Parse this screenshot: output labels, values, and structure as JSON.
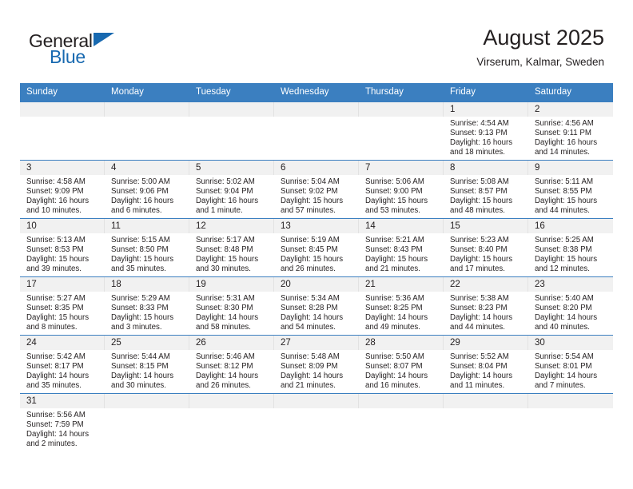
{
  "brand": {
    "name_part1": "General",
    "name_part2": "Blue",
    "accent_color": "#1869b0"
  },
  "header": {
    "title": "August 2025",
    "subtitle": "Virserum, Kalmar, Sweden"
  },
  "theme": {
    "header_blue": "#3b7fc0",
    "day_strip_gray": "#f1f1f1",
    "text": "#231f20"
  },
  "weekdays": [
    "Sunday",
    "Monday",
    "Tuesday",
    "Wednesday",
    "Thursday",
    "Friday",
    "Saturday"
  ],
  "weeks": [
    [
      {
        "day": "",
        "sunrise": "",
        "sunset": "",
        "daylight_line1": "",
        "daylight_line2": ""
      },
      {
        "day": "",
        "sunrise": "",
        "sunset": "",
        "daylight_line1": "",
        "daylight_line2": ""
      },
      {
        "day": "",
        "sunrise": "",
        "sunset": "",
        "daylight_line1": "",
        "daylight_line2": ""
      },
      {
        "day": "",
        "sunrise": "",
        "sunset": "",
        "daylight_line1": "",
        "daylight_line2": ""
      },
      {
        "day": "",
        "sunrise": "",
        "sunset": "",
        "daylight_line1": "",
        "daylight_line2": ""
      },
      {
        "day": "1",
        "sunrise": "Sunrise: 4:54 AM",
        "sunset": "Sunset: 9:13 PM",
        "daylight_line1": "Daylight: 16 hours",
        "daylight_line2": "and 18 minutes."
      },
      {
        "day": "2",
        "sunrise": "Sunrise: 4:56 AM",
        "sunset": "Sunset: 9:11 PM",
        "daylight_line1": "Daylight: 16 hours",
        "daylight_line2": "and 14 minutes."
      }
    ],
    [
      {
        "day": "3",
        "sunrise": "Sunrise: 4:58 AM",
        "sunset": "Sunset: 9:09 PM",
        "daylight_line1": "Daylight: 16 hours",
        "daylight_line2": "and 10 minutes."
      },
      {
        "day": "4",
        "sunrise": "Sunrise: 5:00 AM",
        "sunset": "Sunset: 9:06 PM",
        "daylight_line1": "Daylight: 16 hours",
        "daylight_line2": "and 6 minutes."
      },
      {
        "day": "5",
        "sunrise": "Sunrise: 5:02 AM",
        "sunset": "Sunset: 9:04 PM",
        "daylight_line1": "Daylight: 16 hours",
        "daylight_line2": "and 1 minute."
      },
      {
        "day": "6",
        "sunrise": "Sunrise: 5:04 AM",
        "sunset": "Sunset: 9:02 PM",
        "daylight_line1": "Daylight: 15 hours",
        "daylight_line2": "and 57 minutes."
      },
      {
        "day": "7",
        "sunrise": "Sunrise: 5:06 AM",
        "sunset": "Sunset: 9:00 PM",
        "daylight_line1": "Daylight: 15 hours",
        "daylight_line2": "and 53 minutes."
      },
      {
        "day": "8",
        "sunrise": "Sunrise: 5:08 AM",
        "sunset": "Sunset: 8:57 PM",
        "daylight_line1": "Daylight: 15 hours",
        "daylight_line2": "and 48 minutes."
      },
      {
        "day": "9",
        "sunrise": "Sunrise: 5:11 AM",
        "sunset": "Sunset: 8:55 PM",
        "daylight_line1": "Daylight: 15 hours",
        "daylight_line2": "and 44 minutes."
      }
    ],
    [
      {
        "day": "10",
        "sunrise": "Sunrise: 5:13 AM",
        "sunset": "Sunset: 8:53 PM",
        "daylight_line1": "Daylight: 15 hours",
        "daylight_line2": "and 39 minutes."
      },
      {
        "day": "11",
        "sunrise": "Sunrise: 5:15 AM",
        "sunset": "Sunset: 8:50 PM",
        "daylight_line1": "Daylight: 15 hours",
        "daylight_line2": "and 35 minutes."
      },
      {
        "day": "12",
        "sunrise": "Sunrise: 5:17 AM",
        "sunset": "Sunset: 8:48 PM",
        "daylight_line1": "Daylight: 15 hours",
        "daylight_line2": "and 30 minutes."
      },
      {
        "day": "13",
        "sunrise": "Sunrise: 5:19 AM",
        "sunset": "Sunset: 8:45 PM",
        "daylight_line1": "Daylight: 15 hours",
        "daylight_line2": "and 26 minutes."
      },
      {
        "day": "14",
        "sunrise": "Sunrise: 5:21 AM",
        "sunset": "Sunset: 8:43 PM",
        "daylight_line1": "Daylight: 15 hours",
        "daylight_line2": "and 21 minutes."
      },
      {
        "day": "15",
        "sunrise": "Sunrise: 5:23 AM",
        "sunset": "Sunset: 8:40 PM",
        "daylight_line1": "Daylight: 15 hours",
        "daylight_line2": "and 17 minutes."
      },
      {
        "day": "16",
        "sunrise": "Sunrise: 5:25 AM",
        "sunset": "Sunset: 8:38 PM",
        "daylight_line1": "Daylight: 15 hours",
        "daylight_line2": "and 12 minutes."
      }
    ],
    [
      {
        "day": "17",
        "sunrise": "Sunrise: 5:27 AM",
        "sunset": "Sunset: 8:35 PM",
        "daylight_line1": "Daylight: 15 hours",
        "daylight_line2": "and 8 minutes."
      },
      {
        "day": "18",
        "sunrise": "Sunrise: 5:29 AM",
        "sunset": "Sunset: 8:33 PM",
        "daylight_line1": "Daylight: 15 hours",
        "daylight_line2": "and 3 minutes."
      },
      {
        "day": "19",
        "sunrise": "Sunrise: 5:31 AM",
        "sunset": "Sunset: 8:30 PM",
        "daylight_line1": "Daylight: 14 hours",
        "daylight_line2": "and 58 minutes."
      },
      {
        "day": "20",
        "sunrise": "Sunrise: 5:34 AM",
        "sunset": "Sunset: 8:28 PM",
        "daylight_line1": "Daylight: 14 hours",
        "daylight_line2": "and 54 minutes."
      },
      {
        "day": "21",
        "sunrise": "Sunrise: 5:36 AM",
        "sunset": "Sunset: 8:25 PM",
        "daylight_line1": "Daylight: 14 hours",
        "daylight_line2": "and 49 minutes."
      },
      {
        "day": "22",
        "sunrise": "Sunrise: 5:38 AM",
        "sunset": "Sunset: 8:23 PM",
        "daylight_line1": "Daylight: 14 hours",
        "daylight_line2": "and 44 minutes."
      },
      {
        "day": "23",
        "sunrise": "Sunrise: 5:40 AM",
        "sunset": "Sunset: 8:20 PM",
        "daylight_line1": "Daylight: 14 hours",
        "daylight_line2": "and 40 minutes."
      }
    ],
    [
      {
        "day": "24",
        "sunrise": "Sunrise: 5:42 AM",
        "sunset": "Sunset: 8:17 PM",
        "daylight_line1": "Daylight: 14 hours",
        "daylight_line2": "and 35 minutes."
      },
      {
        "day": "25",
        "sunrise": "Sunrise: 5:44 AM",
        "sunset": "Sunset: 8:15 PM",
        "daylight_line1": "Daylight: 14 hours",
        "daylight_line2": "and 30 minutes."
      },
      {
        "day": "26",
        "sunrise": "Sunrise: 5:46 AM",
        "sunset": "Sunset: 8:12 PM",
        "daylight_line1": "Daylight: 14 hours",
        "daylight_line2": "and 26 minutes."
      },
      {
        "day": "27",
        "sunrise": "Sunrise: 5:48 AM",
        "sunset": "Sunset: 8:09 PM",
        "daylight_line1": "Daylight: 14 hours",
        "daylight_line2": "and 21 minutes."
      },
      {
        "day": "28",
        "sunrise": "Sunrise: 5:50 AM",
        "sunset": "Sunset: 8:07 PM",
        "daylight_line1": "Daylight: 14 hours",
        "daylight_line2": "and 16 minutes."
      },
      {
        "day": "29",
        "sunrise": "Sunrise: 5:52 AM",
        "sunset": "Sunset: 8:04 PM",
        "daylight_line1": "Daylight: 14 hours",
        "daylight_line2": "and 11 minutes."
      },
      {
        "day": "30",
        "sunrise": "Sunrise: 5:54 AM",
        "sunset": "Sunset: 8:01 PM",
        "daylight_line1": "Daylight: 14 hours",
        "daylight_line2": "and 7 minutes."
      }
    ],
    [
      {
        "day": "31",
        "sunrise": "Sunrise: 5:56 AM",
        "sunset": "Sunset: 7:59 PM",
        "daylight_line1": "Daylight: 14 hours",
        "daylight_line2": "and 2 minutes."
      },
      {
        "day": "",
        "sunrise": "",
        "sunset": "",
        "daylight_line1": "",
        "daylight_line2": ""
      },
      {
        "day": "",
        "sunrise": "",
        "sunset": "",
        "daylight_line1": "",
        "daylight_line2": ""
      },
      {
        "day": "",
        "sunrise": "",
        "sunset": "",
        "daylight_line1": "",
        "daylight_line2": ""
      },
      {
        "day": "",
        "sunrise": "",
        "sunset": "",
        "daylight_line1": "",
        "daylight_line2": ""
      },
      {
        "day": "",
        "sunrise": "",
        "sunset": "",
        "daylight_line1": "",
        "daylight_line2": ""
      },
      {
        "day": "",
        "sunrise": "",
        "sunset": "",
        "daylight_line1": "",
        "daylight_line2": ""
      }
    ]
  ]
}
